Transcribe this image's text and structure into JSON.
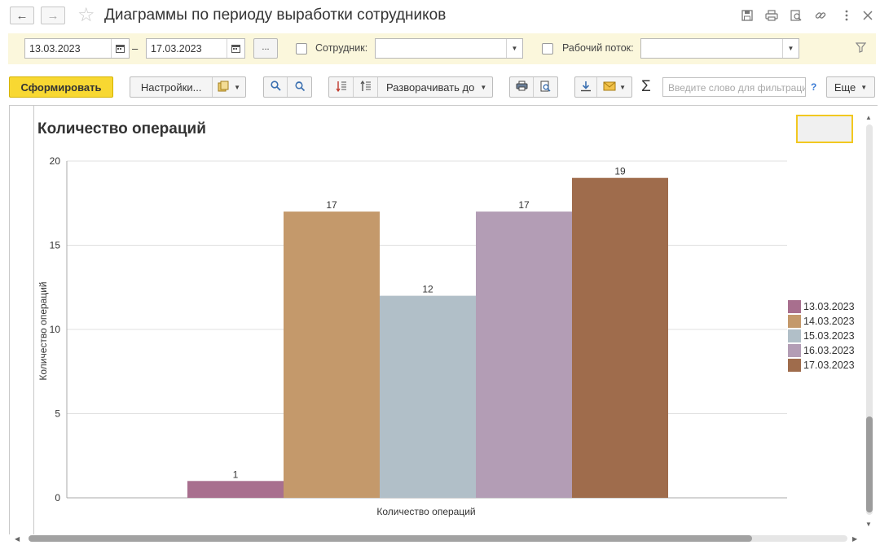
{
  "window": {
    "title": "Диаграммы по периоду выработки сотрудников",
    "icons": [
      "back-icon",
      "forward-icon",
      "favorite-star-icon",
      "save-icon",
      "print-icon",
      "preview-icon",
      "link-icon",
      "more-icon",
      "close-icon"
    ]
  },
  "filters": {
    "date_from": "13.03.2023",
    "date_separator": "–",
    "date_to": "17.03.2023",
    "period_button": "...",
    "employee_label": "Сотрудник:",
    "employee_value": "",
    "workflow_label": "Рабочий поток:",
    "workflow_value": ""
  },
  "toolbar": {
    "generate_label": "Сформировать",
    "settings_label": "Настройки...",
    "expand_label": "Разворачивать до",
    "search_placeholder": "Введите слово для фильтрации",
    "help_label": "?",
    "more_label": "Еще"
  },
  "chart_data": {
    "type": "bar",
    "title": "Количество операций",
    "xlabel": "Количество операций",
    "ylabel": "Количество операций",
    "categories": [
      "Количество операций"
    ],
    "series": [
      {
        "name": "13.03.2023",
        "values": [
          1
        ],
        "color": "#a86f8e"
      },
      {
        "name": "14.03.2023",
        "values": [
          17
        ],
        "color": "#c4996b"
      },
      {
        "name": "15.03.2023",
        "values": [
          12
        ],
        "color": "#b1bfc8"
      },
      {
        "name": "16.03.2023",
        "values": [
          17
        ],
        "color": "#b39db5"
      },
      {
        "name": "17.03.2023",
        "values": [
          19
        ],
        "color": "#9f6c4c"
      }
    ],
    "yticks": [
      0,
      5,
      10,
      15,
      20
    ],
    "ylim": [
      0,
      20
    ],
    "grid": true,
    "legend": "right",
    "data_labels": true
  }
}
